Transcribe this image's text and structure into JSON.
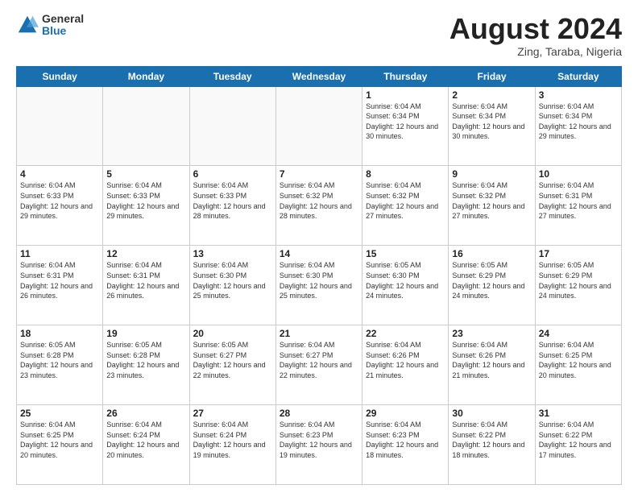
{
  "header": {
    "logo_general": "General",
    "logo_blue": "Blue",
    "month_title": "August 2024",
    "location": "Zing, Taraba, Nigeria"
  },
  "weekdays": [
    "Sunday",
    "Monday",
    "Tuesday",
    "Wednesday",
    "Thursday",
    "Friday",
    "Saturday"
  ],
  "weeks": [
    [
      {
        "day": "",
        "info": ""
      },
      {
        "day": "",
        "info": ""
      },
      {
        "day": "",
        "info": ""
      },
      {
        "day": "",
        "info": ""
      },
      {
        "day": "1",
        "info": "Sunrise: 6:04 AM\nSunset: 6:34 PM\nDaylight: 12 hours\nand 30 minutes."
      },
      {
        "day": "2",
        "info": "Sunrise: 6:04 AM\nSunset: 6:34 PM\nDaylight: 12 hours\nand 30 minutes."
      },
      {
        "day": "3",
        "info": "Sunrise: 6:04 AM\nSunset: 6:34 PM\nDaylight: 12 hours\nand 29 minutes."
      }
    ],
    [
      {
        "day": "4",
        "info": "Sunrise: 6:04 AM\nSunset: 6:33 PM\nDaylight: 12 hours\nand 29 minutes."
      },
      {
        "day": "5",
        "info": "Sunrise: 6:04 AM\nSunset: 6:33 PM\nDaylight: 12 hours\nand 29 minutes."
      },
      {
        "day": "6",
        "info": "Sunrise: 6:04 AM\nSunset: 6:33 PM\nDaylight: 12 hours\nand 28 minutes."
      },
      {
        "day": "7",
        "info": "Sunrise: 6:04 AM\nSunset: 6:32 PM\nDaylight: 12 hours\nand 28 minutes."
      },
      {
        "day": "8",
        "info": "Sunrise: 6:04 AM\nSunset: 6:32 PM\nDaylight: 12 hours\nand 27 minutes."
      },
      {
        "day": "9",
        "info": "Sunrise: 6:04 AM\nSunset: 6:32 PM\nDaylight: 12 hours\nand 27 minutes."
      },
      {
        "day": "10",
        "info": "Sunrise: 6:04 AM\nSunset: 6:31 PM\nDaylight: 12 hours\nand 27 minutes."
      }
    ],
    [
      {
        "day": "11",
        "info": "Sunrise: 6:04 AM\nSunset: 6:31 PM\nDaylight: 12 hours\nand 26 minutes."
      },
      {
        "day": "12",
        "info": "Sunrise: 6:04 AM\nSunset: 6:31 PM\nDaylight: 12 hours\nand 26 minutes."
      },
      {
        "day": "13",
        "info": "Sunrise: 6:04 AM\nSunset: 6:30 PM\nDaylight: 12 hours\nand 25 minutes."
      },
      {
        "day": "14",
        "info": "Sunrise: 6:04 AM\nSunset: 6:30 PM\nDaylight: 12 hours\nand 25 minutes."
      },
      {
        "day": "15",
        "info": "Sunrise: 6:05 AM\nSunset: 6:30 PM\nDaylight: 12 hours\nand 24 minutes."
      },
      {
        "day": "16",
        "info": "Sunrise: 6:05 AM\nSunset: 6:29 PM\nDaylight: 12 hours\nand 24 minutes."
      },
      {
        "day": "17",
        "info": "Sunrise: 6:05 AM\nSunset: 6:29 PM\nDaylight: 12 hours\nand 24 minutes."
      }
    ],
    [
      {
        "day": "18",
        "info": "Sunrise: 6:05 AM\nSunset: 6:28 PM\nDaylight: 12 hours\nand 23 minutes."
      },
      {
        "day": "19",
        "info": "Sunrise: 6:05 AM\nSunset: 6:28 PM\nDaylight: 12 hours\nand 23 minutes."
      },
      {
        "day": "20",
        "info": "Sunrise: 6:05 AM\nSunset: 6:27 PM\nDaylight: 12 hours\nand 22 minutes."
      },
      {
        "day": "21",
        "info": "Sunrise: 6:04 AM\nSunset: 6:27 PM\nDaylight: 12 hours\nand 22 minutes."
      },
      {
        "day": "22",
        "info": "Sunrise: 6:04 AM\nSunset: 6:26 PM\nDaylight: 12 hours\nand 21 minutes."
      },
      {
        "day": "23",
        "info": "Sunrise: 6:04 AM\nSunset: 6:26 PM\nDaylight: 12 hours\nand 21 minutes."
      },
      {
        "day": "24",
        "info": "Sunrise: 6:04 AM\nSunset: 6:25 PM\nDaylight: 12 hours\nand 20 minutes."
      }
    ],
    [
      {
        "day": "25",
        "info": "Sunrise: 6:04 AM\nSunset: 6:25 PM\nDaylight: 12 hours\nand 20 minutes."
      },
      {
        "day": "26",
        "info": "Sunrise: 6:04 AM\nSunset: 6:24 PM\nDaylight: 12 hours\nand 20 minutes."
      },
      {
        "day": "27",
        "info": "Sunrise: 6:04 AM\nSunset: 6:24 PM\nDaylight: 12 hours\nand 19 minutes."
      },
      {
        "day": "28",
        "info": "Sunrise: 6:04 AM\nSunset: 6:23 PM\nDaylight: 12 hours\nand 19 minutes."
      },
      {
        "day": "29",
        "info": "Sunrise: 6:04 AM\nSunset: 6:23 PM\nDaylight: 12 hours\nand 18 minutes."
      },
      {
        "day": "30",
        "info": "Sunrise: 6:04 AM\nSunset: 6:22 PM\nDaylight: 12 hours\nand 18 minutes."
      },
      {
        "day": "31",
        "info": "Sunrise: 6:04 AM\nSunset: 6:22 PM\nDaylight: 12 hours\nand 17 minutes."
      }
    ]
  ]
}
